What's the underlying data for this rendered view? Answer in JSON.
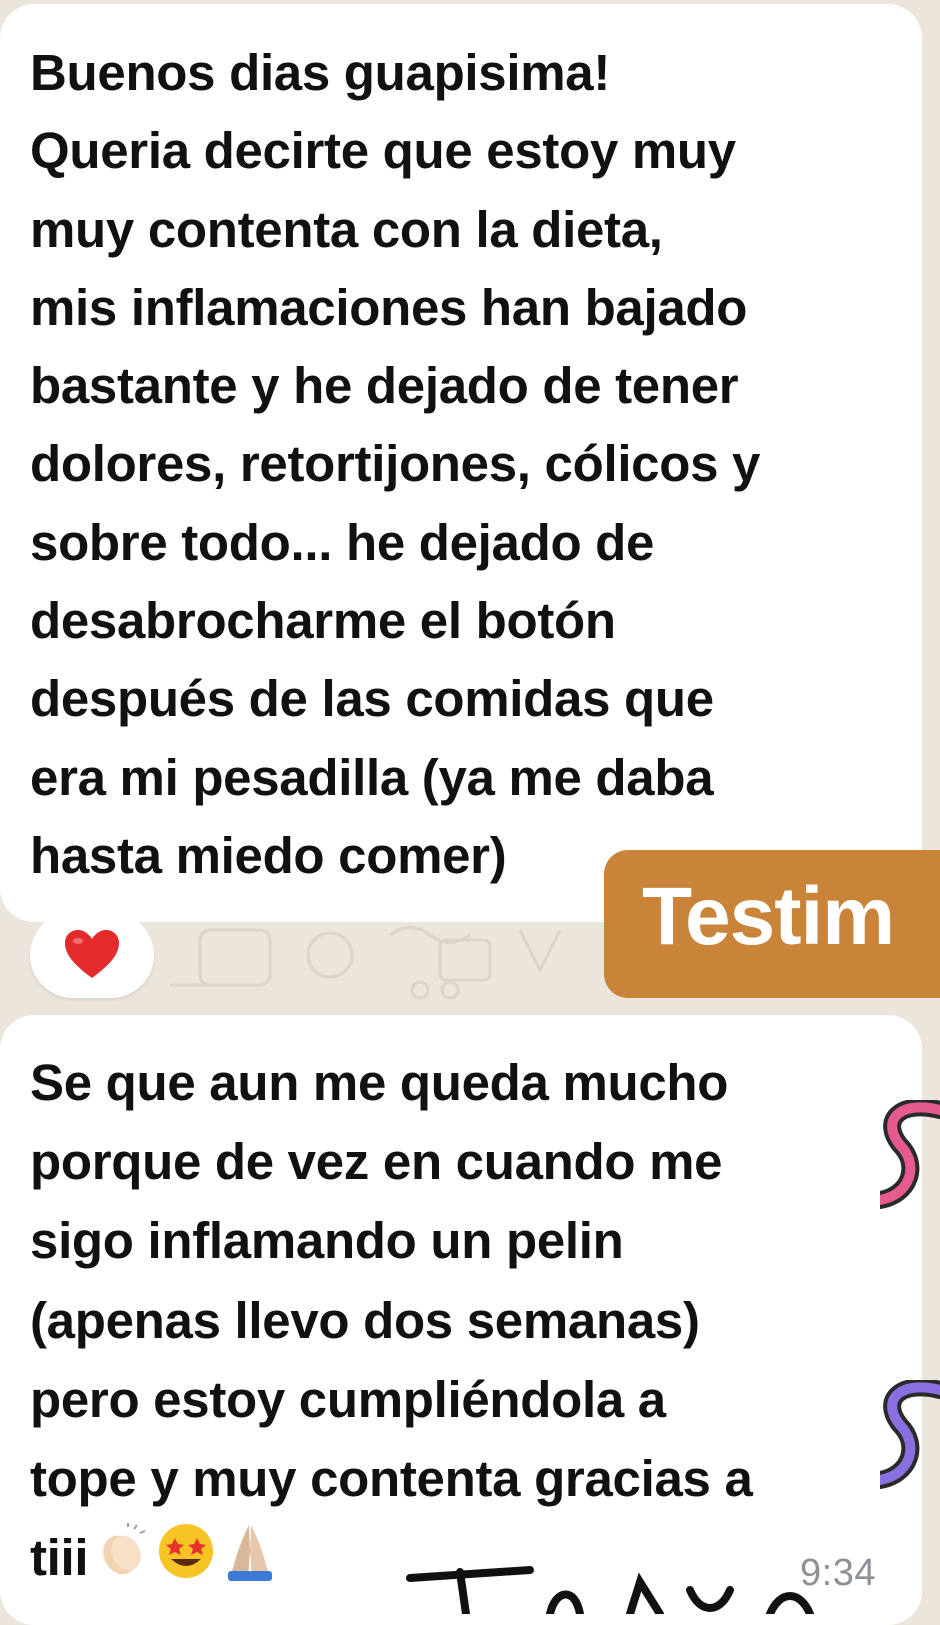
{
  "message_1": {
    "lines": [
      "Buenos dias guapisima!",
      "Queria decirte que estoy muy",
      "muy contenta con la dieta,",
      "mis inflamaciones han bajado",
      "bastante y he dejado de tener",
      "dolores, retortijones, cólicos y",
      "sobre todo... he dejado de",
      "desabrocharme el botón",
      "después de las comidas que",
      "era mi pesadilla (ya me daba",
      "hasta miedo comer)"
    ],
    "reaction": "heart-emoji"
  },
  "sticker": {
    "text": "Testim",
    "color": "#c9843a"
  },
  "message_2": {
    "lines": [
      "Se que aun me queda mucho",
      "porque de vez en cuando me",
      "sigo inflamando un pelin",
      "(apenas llevo dos semanas)",
      "pero estoy cumpliéndola a",
      "tope y muy contenta gracias a",
      "tiii"
    ],
    "emojis": [
      "clapping-hands-emoji",
      "star-struck-emoji",
      "folded-hands-emoji"
    ],
    "time": "9:34"
  },
  "colors": {
    "bubble": "#ffffff",
    "wallpaper": "#ece5dc",
    "timestamp": "#8d9196"
  }
}
